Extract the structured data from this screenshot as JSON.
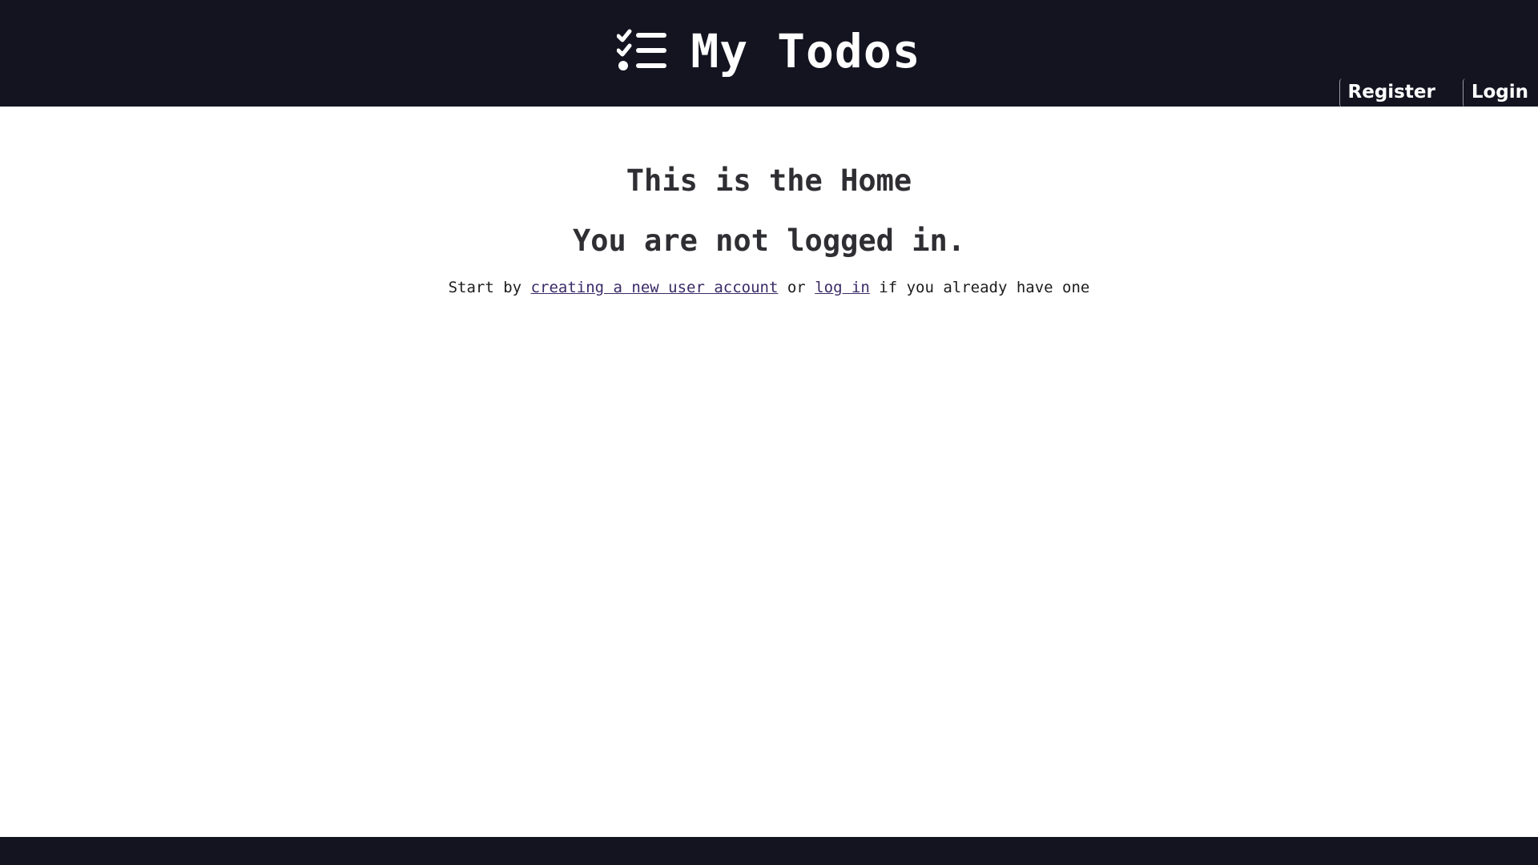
{
  "header": {
    "title": "My Todos",
    "logo_icon": "checklist-icon",
    "nav": {
      "register": "Register",
      "login": "Login"
    }
  },
  "main": {
    "heading": "This is the Home",
    "status": "You are not logged in.",
    "hint": {
      "prefix": "Start by ",
      "register_link": "creating a new user account",
      "middle": " or ",
      "login_link": "log in",
      "suffix": " if you already have one"
    }
  },
  "colors": {
    "header_bg": "#131420",
    "link": "#3a2a66"
  }
}
